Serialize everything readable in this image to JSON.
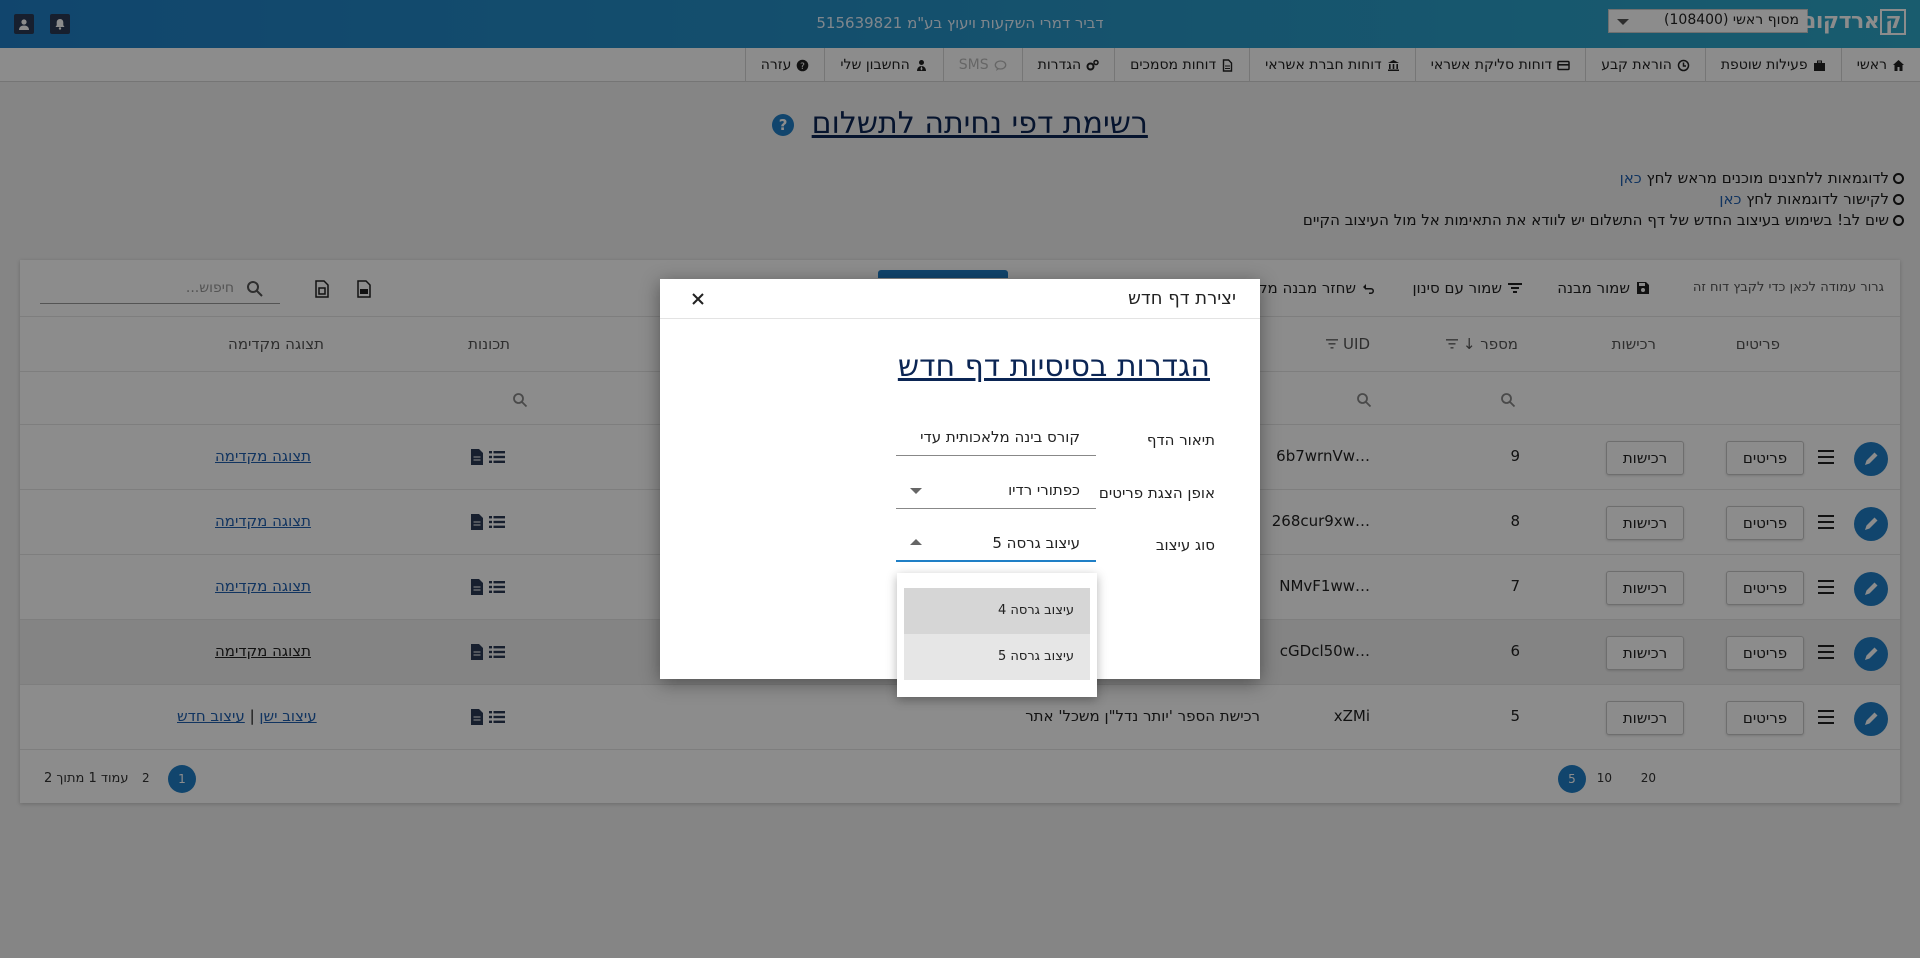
{
  "header": {
    "brand": "ארדקום",
    "brand_k": "ק",
    "company": "דביר דמרי השקעות ויעוץ בע\"מ 515639821",
    "terminal": "מסוף ראשי (108400)"
  },
  "nav": [
    {
      "label": "ראשי",
      "icon": "home-icon"
    },
    {
      "label": "פעילות שוטפת",
      "icon": "briefcase-icon"
    },
    {
      "label": "הוראת קבע",
      "icon": "clock-icon"
    },
    {
      "label": "דוחות סליקת אשראי",
      "icon": "credit-card-icon"
    },
    {
      "label": "דוחות חברת אשראי",
      "icon": "bank-icon"
    },
    {
      "label": "דוחות מסמכים",
      "icon": "document-icon"
    },
    {
      "label": "הגדרות",
      "icon": "gears-icon"
    },
    {
      "label": "SMS",
      "icon": "chat-icon",
      "disabled": true
    },
    {
      "label": "החשבון שלי",
      "icon": "user-tie-icon"
    },
    {
      "label": "עזרה",
      "icon": "question-icon"
    }
  ],
  "page": {
    "title": "רשימת דפי נחיתה לתשלום",
    "help_icon": "?",
    "notes": [
      {
        "text": "לדוגמאות ללחצנים מוכנים מראש לחץ ",
        "link": "כאן"
      },
      {
        "text": "לקישור לדוגמאות לחץ ",
        "link": "כאן"
      },
      {
        "text": "שים לב! בשימוש בעיצוב החדש של דף התשלום יש לוודא את התאימות אל מול העיצוב הקיים",
        "link": ""
      }
    ]
  },
  "toolbar": {
    "drag_hint": "גרור עמודה לכאן כדי לקבץ דוח זה",
    "save_layout": "שמור מבנה",
    "save_filter": "שמור עם סינון",
    "restore_layout": "שחזר מבנה מקורי",
    "search_placeholder": "חיפוש..."
  },
  "table": {
    "headers": {
      "details": "פריטים",
      "purchases": "רכישות",
      "number": "מספר",
      "uid": "UID",
      "features": "תכונות",
      "preview": "תצוגה מקדימה"
    },
    "rows": [
      {
        "number": "9",
        "uid": "…6b7wrnVw",
        "preview": "תצוגה מקדימה",
        "highlight": false
      },
      {
        "number": "8",
        "uid": "…268cur9xw",
        "preview": "תצוגה מקדימה",
        "highlight": false
      },
      {
        "number": "7",
        "uid": "…NMvF1ww",
        "preview": "תצוגה מקדימה",
        "highlight": false
      },
      {
        "number": "6",
        "uid": "…cGDcl50w",
        "preview": "תצוגה מקדימה",
        "highlight": true
      },
      {
        "number": "5",
        "uid": "xZMi",
        "description": "רכישת הספר 'יותר נדל\"ן משכל' אתר",
        "old_design": "עיצוב ישן",
        "sep": "|",
        "new_design": "עיצוב חדש",
        "highlight": false
      }
    ],
    "button_details": "פריטים",
    "button_purchases": "רכישות"
  },
  "pager": {
    "sizes": [
      "5",
      "10",
      "20"
    ],
    "pages": [
      "1",
      "2"
    ],
    "summary": "עמוד 1 מתוך 2"
  },
  "modal": {
    "title": "יצירת דף חדש",
    "heading": "הגדרות בסיסיות דף חדש",
    "fields": {
      "description_label": "תיאור הדף",
      "description_value": "קורס בינה מלאכותית עדי",
      "display_label": "אופן הצגת פריטים",
      "display_value": "כפתורי רדיו",
      "design_label": "סוג עיצוב",
      "design_value": "עיצוב גרסה 5"
    },
    "options": [
      "עיצוב גרסה 4",
      "עיצוב גרסה 5"
    ]
  },
  "colors": {
    "primary": "#1f7fc6",
    "title": "#0b2554",
    "link": "#1f5fb0"
  }
}
